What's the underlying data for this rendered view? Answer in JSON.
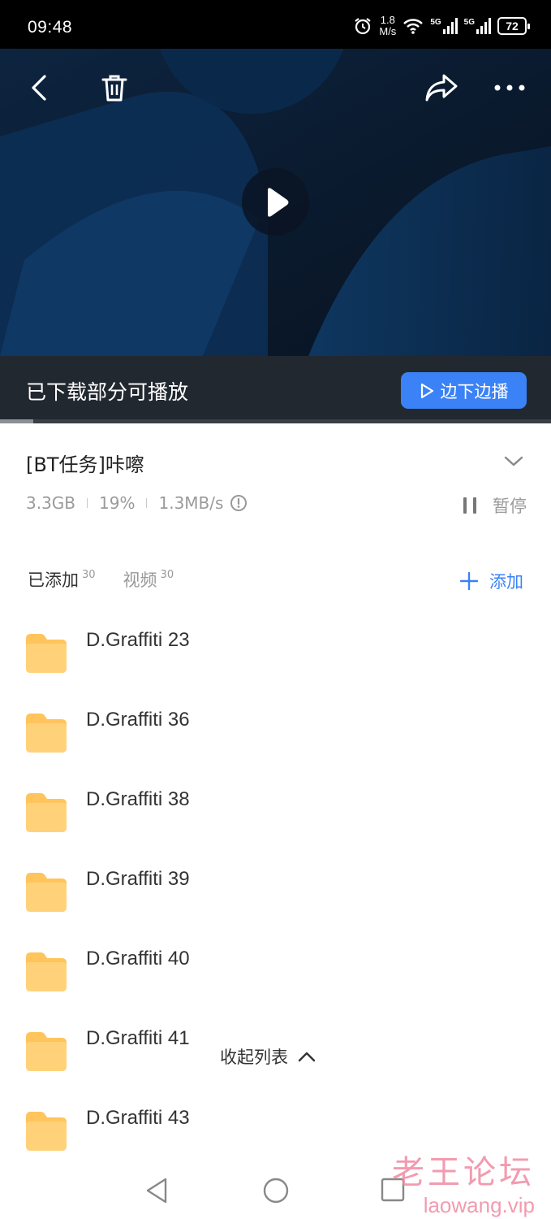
{
  "status_bar": {
    "time": "09:48",
    "net_speed_value": "1.8",
    "net_speed_unit": "M/s",
    "signal1": "5G",
    "signal2": "5G",
    "battery": "72"
  },
  "player": {
    "status_text": "已下载部分可播放",
    "play_while_download_label": "边下边播",
    "progress": 0.06
  },
  "task": {
    "title": "[BT任务]咔嚓",
    "size": "3.3GB",
    "percent": "19%",
    "speed": "1.3MB/s",
    "pause_label": "暂停"
  },
  "tabs": [
    {
      "label": "已添加",
      "count": "30"
    },
    {
      "label": "视频",
      "count": "30"
    }
  ],
  "add_label": "添加",
  "files": [
    {
      "name": "D.Graffiti 23"
    },
    {
      "name": "D.Graffiti 36"
    },
    {
      "name": "D.Graffiti 38"
    },
    {
      "name": "D.Graffiti 39"
    },
    {
      "name": "D.Graffiti 40"
    },
    {
      "name": "D.Graffiti 41"
    },
    {
      "name": "D.Graffiti 43"
    }
  ],
  "collapse_label": "收起列表",
  "watermark": {
    "line1": "老王论坛",
    "line2": "laowang.vip"
  },
  "colors": {
    "accent": "#3b82f6",
    "folder": "#ffc45c",
    "playbar_bg": "#222830"
  }
}
